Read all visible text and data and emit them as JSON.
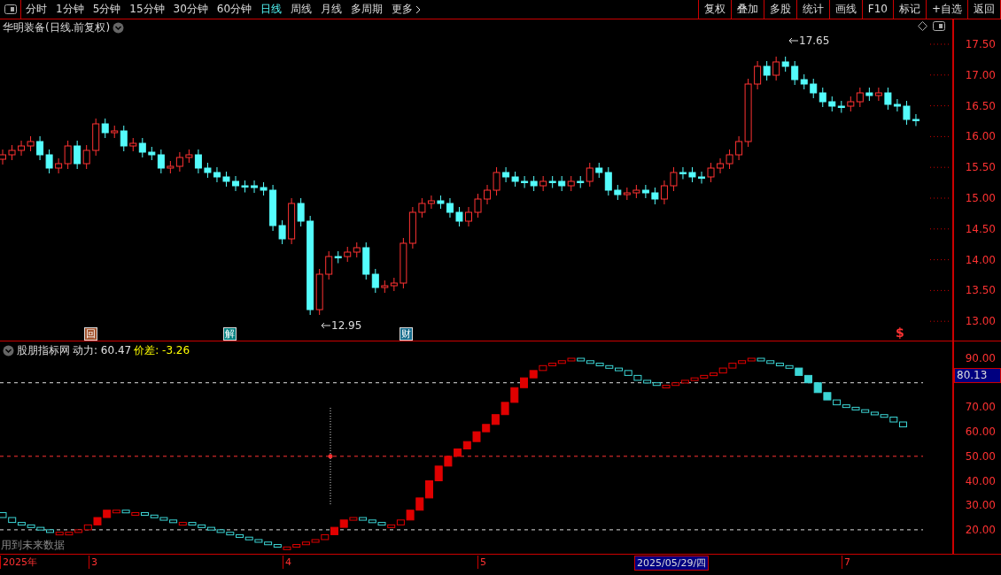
{
  "toolbar": {
    "periods": [
      {
        "label": "分时",
        "selected": false
      },
      {
        "label": "1分钟",
        "selected": false
      },
      {
        "label": "5分钟",
        "selected": false
      },
      {
        "label": "15分钟",
        "selected": false
      },
      {
        "label": "30分钟",
        "selected": false
      },
      {
        "label": "60分钟",
        "selected": false
      },
      {
        "label": "日线",
        "selected": true
      },
      {
        "label": "周线",
        "selected": false
      },
      {
        "label": "月线",
        "selected": false
      },
      {
        "label": "多周期",
        "selected": false
      }
    ],
    "more": "更多",
    "actions": [
      "复权",
      "叠加",
      "多股",
      "统计",
      "画线",
      "F10",
      "标记",
      "+自选",
      "返回"
    ]
  },
  "price_pane": {
    "title": "华明装备(日线.前复权)",
    "high_label": "17.65",
    "low_label": "12.95",
    "y_labels": [
      "17.50",
      "17.00",
      "16.50",
      "16.00",
      "15.50",
      "15.00",
      "14.50",
      "14.00",
      "13.50",
      "13.00"
    ],
    "event_marks": [
      {
        "text": "回",
        "kind": "tag",
        "color": "#a0522d"
      },
      {
        "text": "解",
        "kind": "tag",
        "color": "#008080"
      },
      {
        "text": "财",
        "kind": "tag",
        "color": "#1a6f8f"
      },
      {
        "text": "$",
        "kind": "glyph",
        "color": "#ff3232"
      }
    ]
  },
  "indicator_pane": {
    "name": "股朋指标网",
    "readouts": [
      {
        "text": "动力: 60.47",
        "color": "#e0e0e0"
      },
      {
        "text": "价差: -3.26",
        "color": "#ffff00"
      }
    ],
    "current_value": "80.13",
    "y_labels": [
      "90.00",
      "70.00",
      "60.00",
      "50.00",
      "40.00",
      "30.00",
      "20.00"
    ],
    "warning": "用到未来数据"
  },
  "time_axis": {
    "labels": [
      {
        "text": "2025年",
        "selected": false
      },
      {
        "text": "3",
        "selected": false
      },
      {
        "text": "4",
        "selected": false
      },
      {
        "text": "5",
        "selected": false
      },
      {
        "text": "2025/05/29/四",
        "selected": true
      },
      {
        "text": "7",
        "selected": false
      }
    ]
  }
}
